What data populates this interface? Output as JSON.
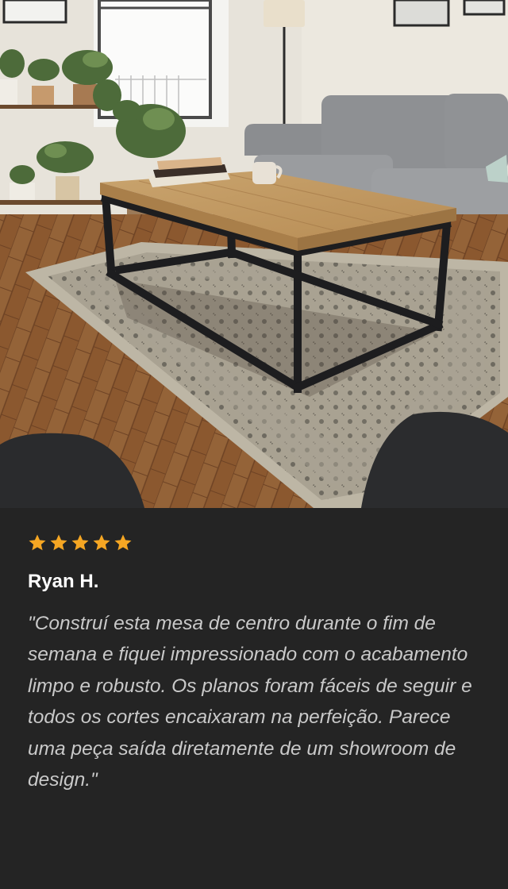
{
  "review": {
    "rating": 5,
    "rating_max": 5,
    "star_color": "#f5a623",
    "reviewer_name": "Ryan H.",
    "quote": "\"Construí esta mesa de centro durante o fim de semana e fiquei impressionado com o acabamento limpo e robusto. Os planos foram fáceis de seguir e todos os cortes encaixaram na perfeição. Parece uma peça saída diretamente de um showroom de design.\""
  },
  "photo": {
    "subject": "coffee-table-photo"
  }
}
